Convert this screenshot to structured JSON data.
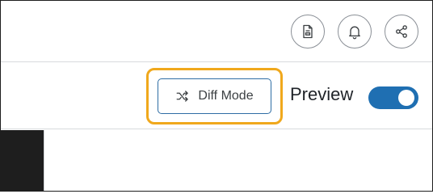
{
  "header": {
    "buttons": [
      {
        "name": "document-button",
        "icon": "document-icon"
      },
      {
        "name": "notifications-button",
        "icon": "bell-icon"
      },
      {
        "name": "share-button",
        "icon": "share-icon"
      }
    ]
  },
  "toolbar": {
    "diff_mode_label": "Diff Mode",
    "diff_mode_icon": "shuffle-icon",
    "preview_label": "Preview",
    "preview_enabled": true
  },
  "colors": {
    "highlight": "#f0a81c",
    "accent": "#1f6fb2",
    "dark_panel": "#1e1e1e"
  }
}
